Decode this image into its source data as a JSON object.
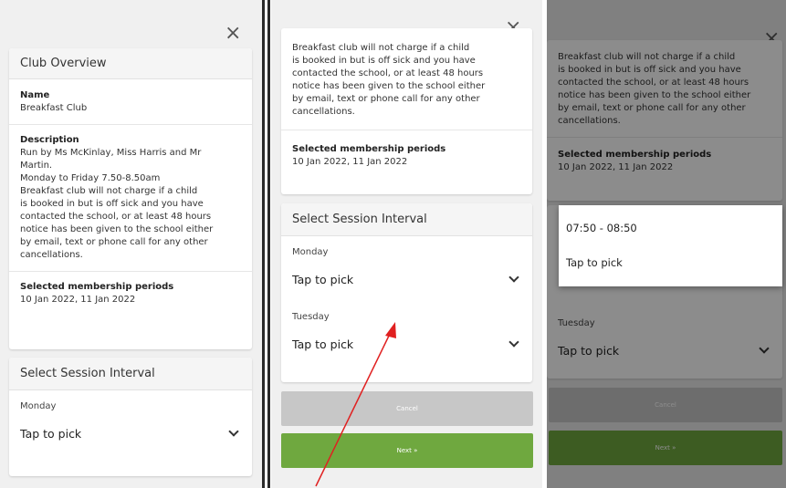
{
  "modal": {
    "close_symbol": "×",
    "overview_title": "Club Overview",
    "name_label": "Name",
    "name_value": "Breakfast Club",
    "description_label": "Description",
    "description_lines": [
      "Run by Ms McKinlay, Miss Harris and Mr",
      "Martin.",
      "Monday to Friday 7.50-8.50am",
      "Breakfast club will not charge if a child",
      "is booked in but is off sick and you have",
      "contacted the school, or at least 48 hours",
      "notice has been given to the school either",
      "by email, text or phone call for any other",
      "cancellations."
    ],
    "membership_label": "Selected membership periods",
    "membership_value": "10 Jan 2022, 11 Jan 2022",
    "session_title": "Select Session Interval",
    "days": [
      {
        "label": "Monday",
        "value": "Tap to pick"
      },
      {
        "label": "Tuesday",
        "value": "Tap to pick"
      }
    ],
    "cancel_label": "Cancel",
    "next_label": "Next »"
  },
  "dropdown": {
    "options": [
      "07:50 - 08:50",
      "Tap to pick"
    ]
  },
  "colors": {
    "next_button": "#6fa83f",
    "cancel_button": "#c7c7c7",
    "arrow": "#e02020"
  },
  "icons": [
    "close-icon",
    "chevron-down-icon"
  ]
}
